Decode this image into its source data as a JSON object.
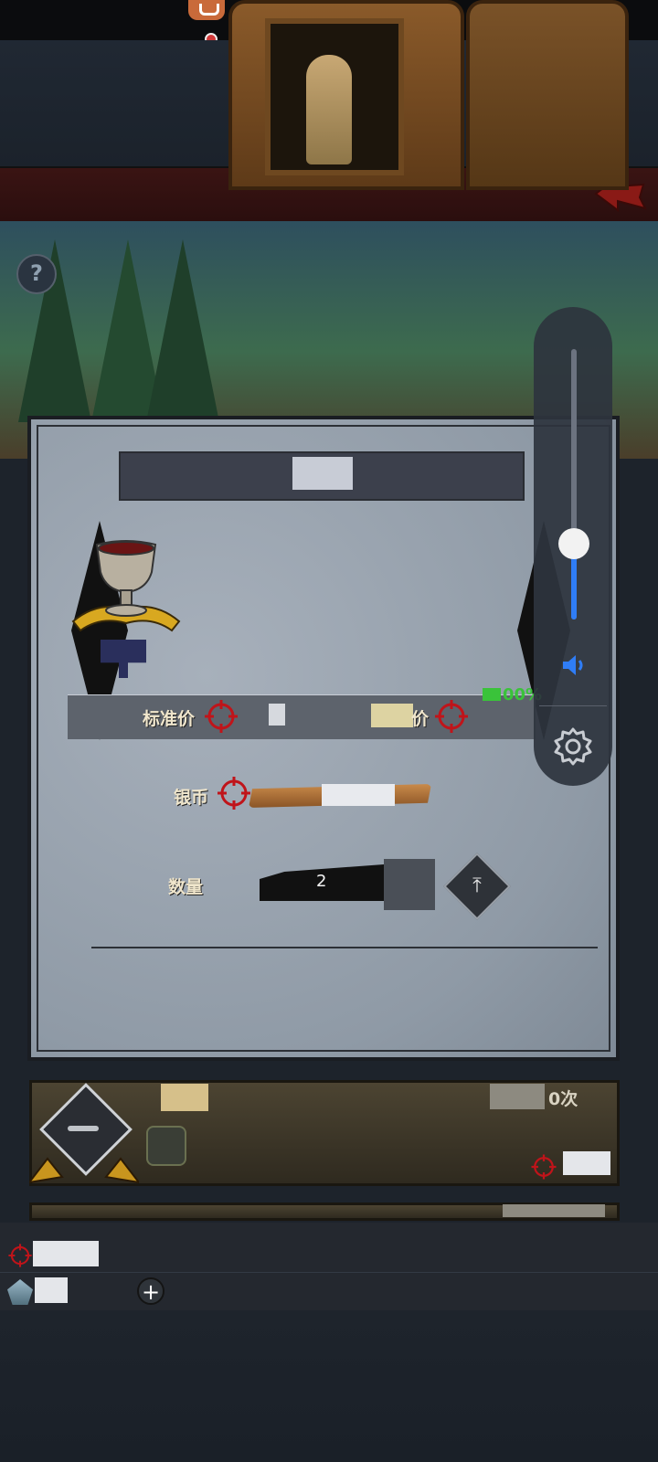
{
  "colors": {
    "accent_blue": "#2f7df6",
    "battery_green": "#3ac33a",
    "crosshair_red": "#c0141a",
    "desc_highlight": "#ddd3a2"
  },
  "help": {
    "icon": "question-icon",
    "label": "?"
  },
  "dialog": {
    "title": "",
    "item": {
      "icon": "goblet-icon",
      "description": ""
    },
    "price": {
      "standard_label": "标准价",
      "alt_label_suffix": "价",
      "currency_icon": "crosshair-icon"
    },
    "battery_text": "00%",
    "silver": {
      "label": "银币",
      "value": ""
    },
    "quantity": {
      "label": "数量",
      "value": "2",
      "max_icon": "arrow-up-to-line-icon",
      "max_glyph": "⤒"
    }
  },
  "volume": {
    "level": 0.28,
    "speaker_icon": "speaker-icon",
    "settings_icon": "gear-icon"
  },
  "list": {
    "card": {
      "remain_suffix": "0次",
      "minus_icon": "minus-icon"
    }
  },
  "bottom": {
    "silver_icon": "crosshair-icon",
    "gem_icon": "crystal-icon",
    "add_label": "+"
  }
}
